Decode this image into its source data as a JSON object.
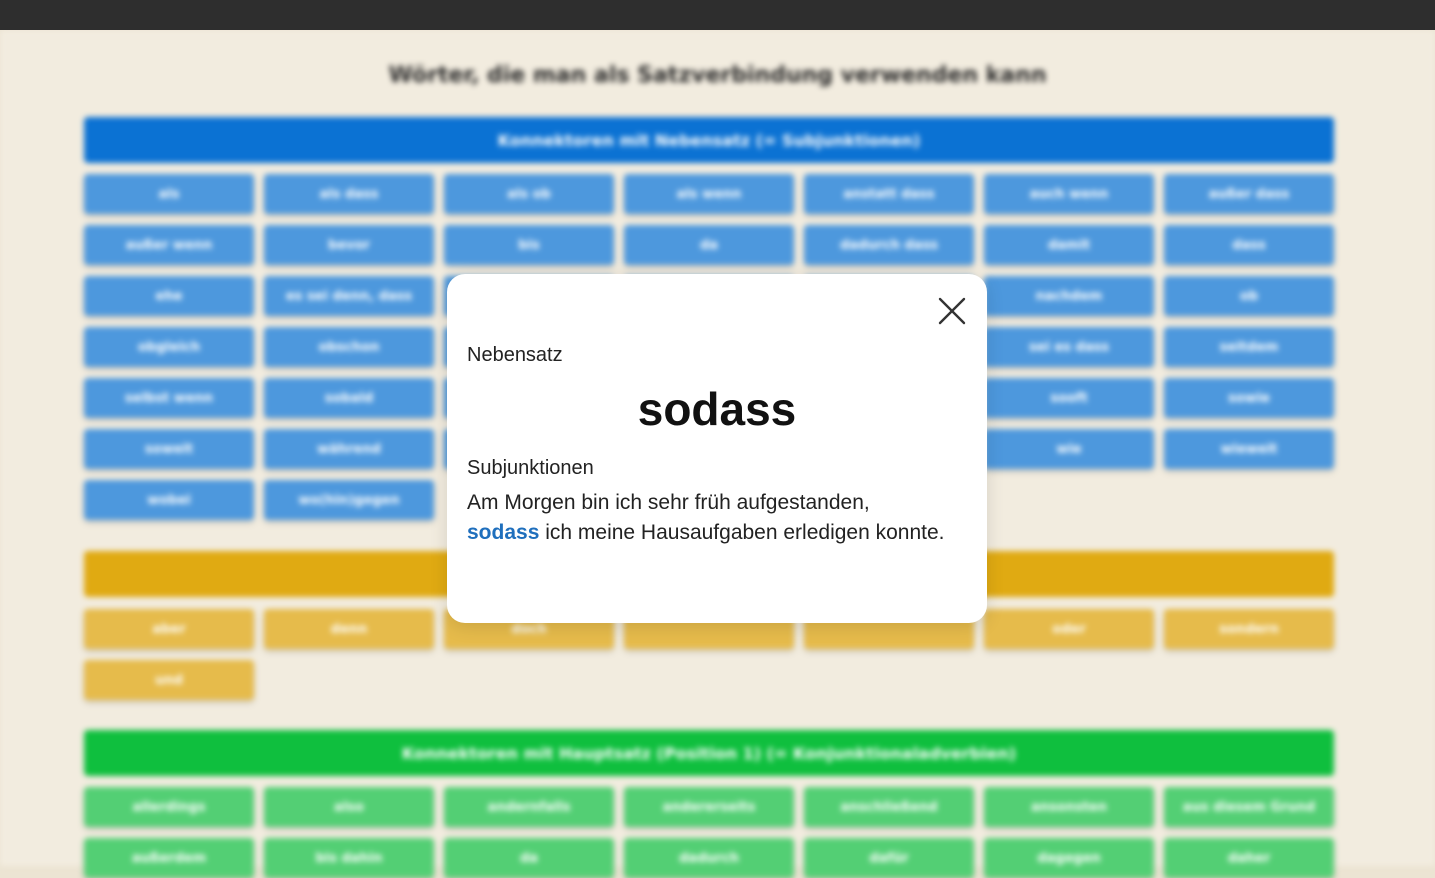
{
  "page": {
    "title": "Wörter, die man als Satzverbindung verwenden kann"
  },
  "sections": {
    "subjunktionen": {
      "title": "Konnektoren mit Nebensatz (= Subjunktionen)",
      "color": "#0b72d3",
      "items": [
        "als",
        "als dass",
        "als ob",
        "als wenn",
        "anstatt dass",
        "auch wenn",
        "außer dass",
        "außer wenn",
        "bevor",
        "bis",
        "da",
        "dadurch dass",
        "damit",
        "dass",
        "ehe",
        "es sei denn, dass",
        "",
        "",
        "",
        "nachdem",
        "ob",
        "obgleich",
        "obschon",
        "",
        "",
        "",
        "sei es dass",
        "seitdem",
        "selbst wenn",
        "sobald",
        "",
        "",
        "",
        "sooft",
        "sowie",
        "soweit",
        "während",
        "",
        "",
        "",
        "wie",
        "wieweit",
        "wobei",
        "wo(hin)gegen"
      ]
    },
    "konjunktionen": {
      "title": "",
      "color": "#e0aa12",
      "items": [
        "aber",
        "denn",
        "doch",
        "",
        "",
        "oder",
        "sondern",
        "und"
      ]
    },
    "konjunktionaladverbien": {
      "title": "Konnektoren mit Hauptsatz (Position 1) (= Konjunktionaladverbien)",
      "color": "#0fbf3e",
      "items": [
        "allerdings",
        "also",
        "andernfalls",
        "andererseits",
        "anschließend",
        "ansonsten",
        "aus diesem Grund",
        "außerdem",
        "bis dahin",
        "da",
        "dadurch",
        "dafür",
        "dagegen",
        "daher"
      ]
    }
  },
  "modal": {
    "type_label": "Nebensatz",
    "word": "sodass",
    "category": "Subjunktionen",
    "example_before": "Am Morgen bin ich sehr früh aufgestanden,",
    "example_highlight": "sodass",
    "example_after": "ich meine Hausaufgaben erledigen konnte.",
    "close_icon": "close-icon"
  }
}
